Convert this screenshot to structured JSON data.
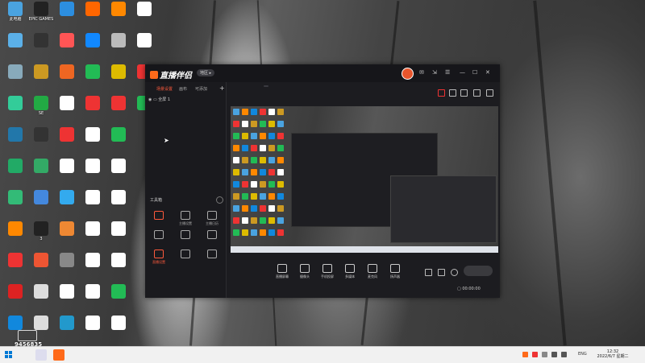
{
  "desktop": {
    "icons_col1": [
      {
        "label": "此电脑",
        "color": "#4aa3e0"
      },
      {
        "label": "",
        "color": "#5bb0e8"
      },
      {
        "label": "",
        "color": "#8ab"
      },
      {
        "label": "",
        "color": "#3c9"
      },
      {
        "label": "",
        "color": "#27a"
      },
      {
        "label": "",
        "color": "#2a6"
      },
      {
        "label": "",
        "color": "#3b7"
      },
      {
        "label": "",
        "color": "#f80"
      },
      {
        "label": "",
        "color": "#e33"
      },
      {
        "label": "",
        "color": "#d22"
      },
      {
        "label": "",
        "color": "#18d"
      }
    ],
    "icons_col2": [
      {
        "label": "EPIC GAMES",
        "color": "#222"
      },
      {
        "label": "",
        "color": "#333"
      },
      {
        "label": "",
        "color": "#c92"
      },
      {
        "label": "SE",
        "color": "#2a4"
      },
      {
        "label": "",
        "color": "#333"
      },
      {
        "label": "",
        "color": "#3a6"
      },
      {
        "label": "",
        "color": "#48d"
      },
      {
        "label": "3",
        "color": "#222"
      },
      {
        "label": "",
        "color": "#e53"
      },
      {
        "label": "",
        "color": "#ddd"
      },
      {
        "label": "",
        "color": "#ddd"
      }
    ],
    "icons_col3": [
      {
        "label": "",
        "color": "#2c8ee0"
      },
      {
        "label": "",
        "color": "#f55"
      },
      {
        "label": "",
        "color": "#e62"
      },
      {
        "label": "",
        "color": "#fff"
      },
      {
        "label": "",
        "color": "#e33"
      },
      {
        "label": "",
        "color": "#fff"
      },
      {
        "label": "",
        "color": "#3ae"
      },
      {
        "label": "",
        "color": "#e83"
      },
      {
        "label": "",
        "color": "#888"
      },
      {
        "label": "",
        "color": "#fff"
      },
      {
        "label": "",
        "color": "#29c"
      }
    ],
    "icons_col4": [
      {
        "label": "",
        "color": "#f60"
      },
      {
        "label": "",
        "color": "#18f"
      },
      {
        "label": "",
        "color": "#2b5"
      },
      {
        "label": "",
        "color": "#e33"
      },
      {
        "label": "",
        "color": "#fff"
      },
      {
        "label": "",
        "color": "#fff"
      },
      {
        "label": "",
        "color": "#fff"
      },
      {
        "label": "",
        "color": "#fff"
      },
      {
        "label": "",
        "color": "#fff"
      },
      {
        "label": "",
        "color": "#fff"
      },
      {
        "label": "",
        "color": "#fff"
      }
    ],
    "icons_col5": [
      {
        "label": "",
        "color": "#f80"
      },
      {
        "label": "",
        "color": "#bbb"
      },
      {
        "label": "",
        "color": "#db0"
      },
      {
        "label": "",
        "color": "#e33"
      },
      {
        "label": "",
        "color": "#2b5"
      },
      {
        "label": "",
        "color": "#fff"
      },
      {
        "label": "",
        "color": "#fff"
      },
      {
        "label": "",
        "color": "#fff"
      },
      {
        "label": "",
        "color": "#fff"
      },
      {
        "label": "",
        "color": "#2b5"
      },
      {
        "label": "",
        "color": "#fff"
      }
    ],
    "icons_col6": [
      {
        "label": "",
        "color": "#fff"
      },
      {
        "label": "",
        "color": "#fff"
      },
      {
        "label": "",
        "color": "#e33"
      },
      {
        "label": "",
        "color": "#2b5"
      }
    ]
  },
  "app": {
    "logo_text": "直播伴侣",
    "region_label": "地区",
    "tabs": [
      "场景设置",
      "画布",
      "可添加"
    ],
    "scene_name": "全屏 1",
    "toolbox_title": "工具箱",
    "tools": [
      {
        "label": "",
        "hot": true
      },
      {
        "label": "主播设置",
        "hot": false
      },
      {
        "label": "主播日历",
        "hot": false
      },
      {
        "label": "",
        "hot": false
      },
      {
        "label": "",
        "hot": false
      },
      {
        "label": "",
        "hot": false
      },
      {
        "label": "直播设置",
        "hot": true
      },
      {
        "label": "",
        "hot": false
      },
      {
        "label": "",
        "hot": false
      }
    ],
    "notice": "",
    "room_title": "",
    "room_tag": "",
    "room_line2": "",
    "controls": [
      {
        "label": "直播屏幕"
      },
      {
        "label": "摄像头"
      },
      {
        "label": "手机投屏"
      },
      {
        "label": "多媒体"
      },
      {
        "label": "麦克风"
      },
      {
        "label": "扬声器"
      }
    ],
    "golive_label": "",
    "timer": "00:00:00"
  },
  "watermark": {
    "id": "9456835"
  },
  "taskbar": {
    "lang": "ENG",
    "time": "12:32",
    "date": "2022/6/7 星期二",
    "accent": "#0078d4"
  }
}
